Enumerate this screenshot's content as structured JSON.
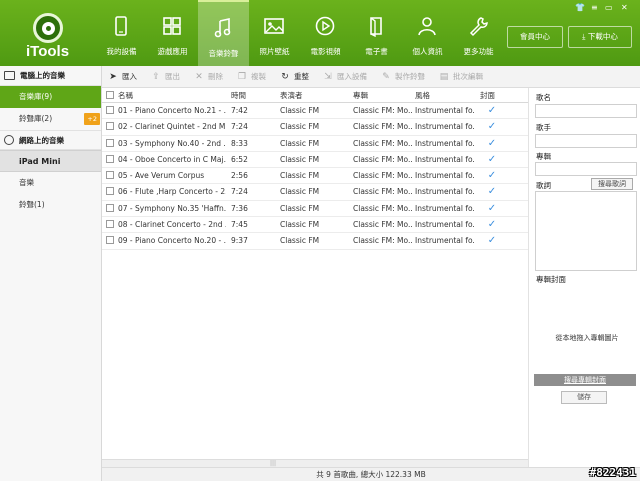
{
  "app": {
    "logo": "iTools"
  },
  "nav": [
    {
      "label": "我的設備",
      "icon": "phone-icon",
      "active": false
    },
    {
      "label": "遊戲應用",
      "icon": "apps-grid-icon",
      "active": false
    },
    {
      "label": "音樂鈴聲",
      "icon": "music-note-icon",
      "active": true
    },
    {
      "label": "照片壁紙",
      "icon": "image-icon",
      "active": false
    },
    {
      "label": "電影視頻",
      "icon": "play-icon",
      "active": false
    },
    {
      "label": "電子書",
      "icon": "book-icon",
      "active": false
    },
    {
      "label": "個人資訊",
      "icon": "person-icon",
      "active": false
    },
    {
      "label": "更多功能",
      "icon": "wrench-icon",
      "active": false
    }
  ],
  "header_buttons": {
    "member": "會員中心",
    "download": "下載中心"
  },
  "toolbar": {
    "import": "匯入",
    "export": "匯出",
    "delete": "刪除",
    "copy": "複製",
    "refresh": "重整",
    "import_device": "匯入設備",
    "make_ringtone": "製作鈴聲",
    "id3_edit": "批次編輯"
  },
  "sidebar": {
    "pc_music": "電腦上的音樂",
    "library": "音樂庫(9)",
    "ringtones": "鈴聲庫(2)",
    "badge": "+2",
    "online_music": "網路上的音樂",
    "device": "iPad Mini",
    "device_music": "音樂",
    "device_ringtones": "鈴聲(1)"
  },
  "table": {
    "headers": {
      "name": "名稱",
      "time": "時間",
      "artist": "表演者",
      "album": "專輯",
      "genre": "風格",
      "cover": "封面"
    },
    "rows": [
      {
        "name": "01 - Piano Concerto No.21 - ...",
        "time": "7:42",
        "artist": "Classic FM",
        "album": "Classic FM: Mo...",
        "genre": "Instrumental fo...",
        "cover": "✓"
      },
      {
        "name": "02 - Clarinet Quintet - 2nd M...",
        "time": "7:24",
        "artist": "Classic FM",
        "album": "Classic FM: Mo...",
        "genre": "Instrumental fo...",
        "cover": "✓"
      },
      {
        "name": "03 - Symphony No.40 - 2nd ...",
        "time": "8:33",
        "artist": "Classic FM",
        "album": "Classic FM: Mo...",
        "genre": "Instrumental fo...",
        "cover": "✓"
      },
      {
        "name": "04 - Oboe Concerto in C Maj...",
        "time": "6:52",
        "artist": "Classic FM",
        "album": "Classic FM: Mo...",
        "genre": "Instrumental fo...",
        "cover": "✓"
      },
      {
        "name": "05 - Ave Verum Corpus",
        "time": "2:56",
        "artist": "Classic FM",
        "album": "Classic FM: Mo...",
        "genre": "Instrumental fo...",
        "cover": "✓"
      },
      {
        "name": "06 - Flute ,Harp Concerto - 2...",
        "time": "7:24",
        "artist": "Classic FM",
        "album": "Classic FM: Mo...",
        "genre": "Instrumental fo...",
        "cover": "✓"
      },
      {
        "name": "07 - Symphony No.35 'Haffn...",
        "time": "7:36",
        "artist": "Classic FM",
        "album": "Classic FM: Mo...",
        "genre": "Instrumental fo...",
        "cover": "✓"
      },
      {
        "name": "08 - Clarinet Concerto - 2nd ...",
        "time": "7:45",
        "artist": "Classic FM",
        "album": "Classic FM: Mo...",
        "genre": "Instrumental fo...",
        "cover": "✓"
      },
      {
        "name": "09 - Piano Concerto No.20 - ...",
        "time": "9:37",
        "artist": "Classic FM",
        "album": "Classic FM: Mo...",
        "genre": "Instrumental fo...",
        "cover": "✓"
      }
    ]
  },
  "status": "共 9 首歌曲, 總大小 122.33 MB",
  "right_panel": {
    "name_label": "歌名",
    "artist_label": "歌手",
    "album_label": "專輯",
    "lyrics_label": "歌詞",
    "lyrics_button": "搜尋歌詞",
    "cover_label": "專輯封面",
    "cover_hint": "從本地拖入專輯圖片",
    "cover_search": "搜尋專輯封面",
    "save": "儲存"
  },
  "watermark": "#822431",
  "colors": {
    "header": "#5ba316",
    "active_sidebar": "#5fa617",
    "badge": "#f0a21a",
    "check": "#3b8ede"
  }
}
